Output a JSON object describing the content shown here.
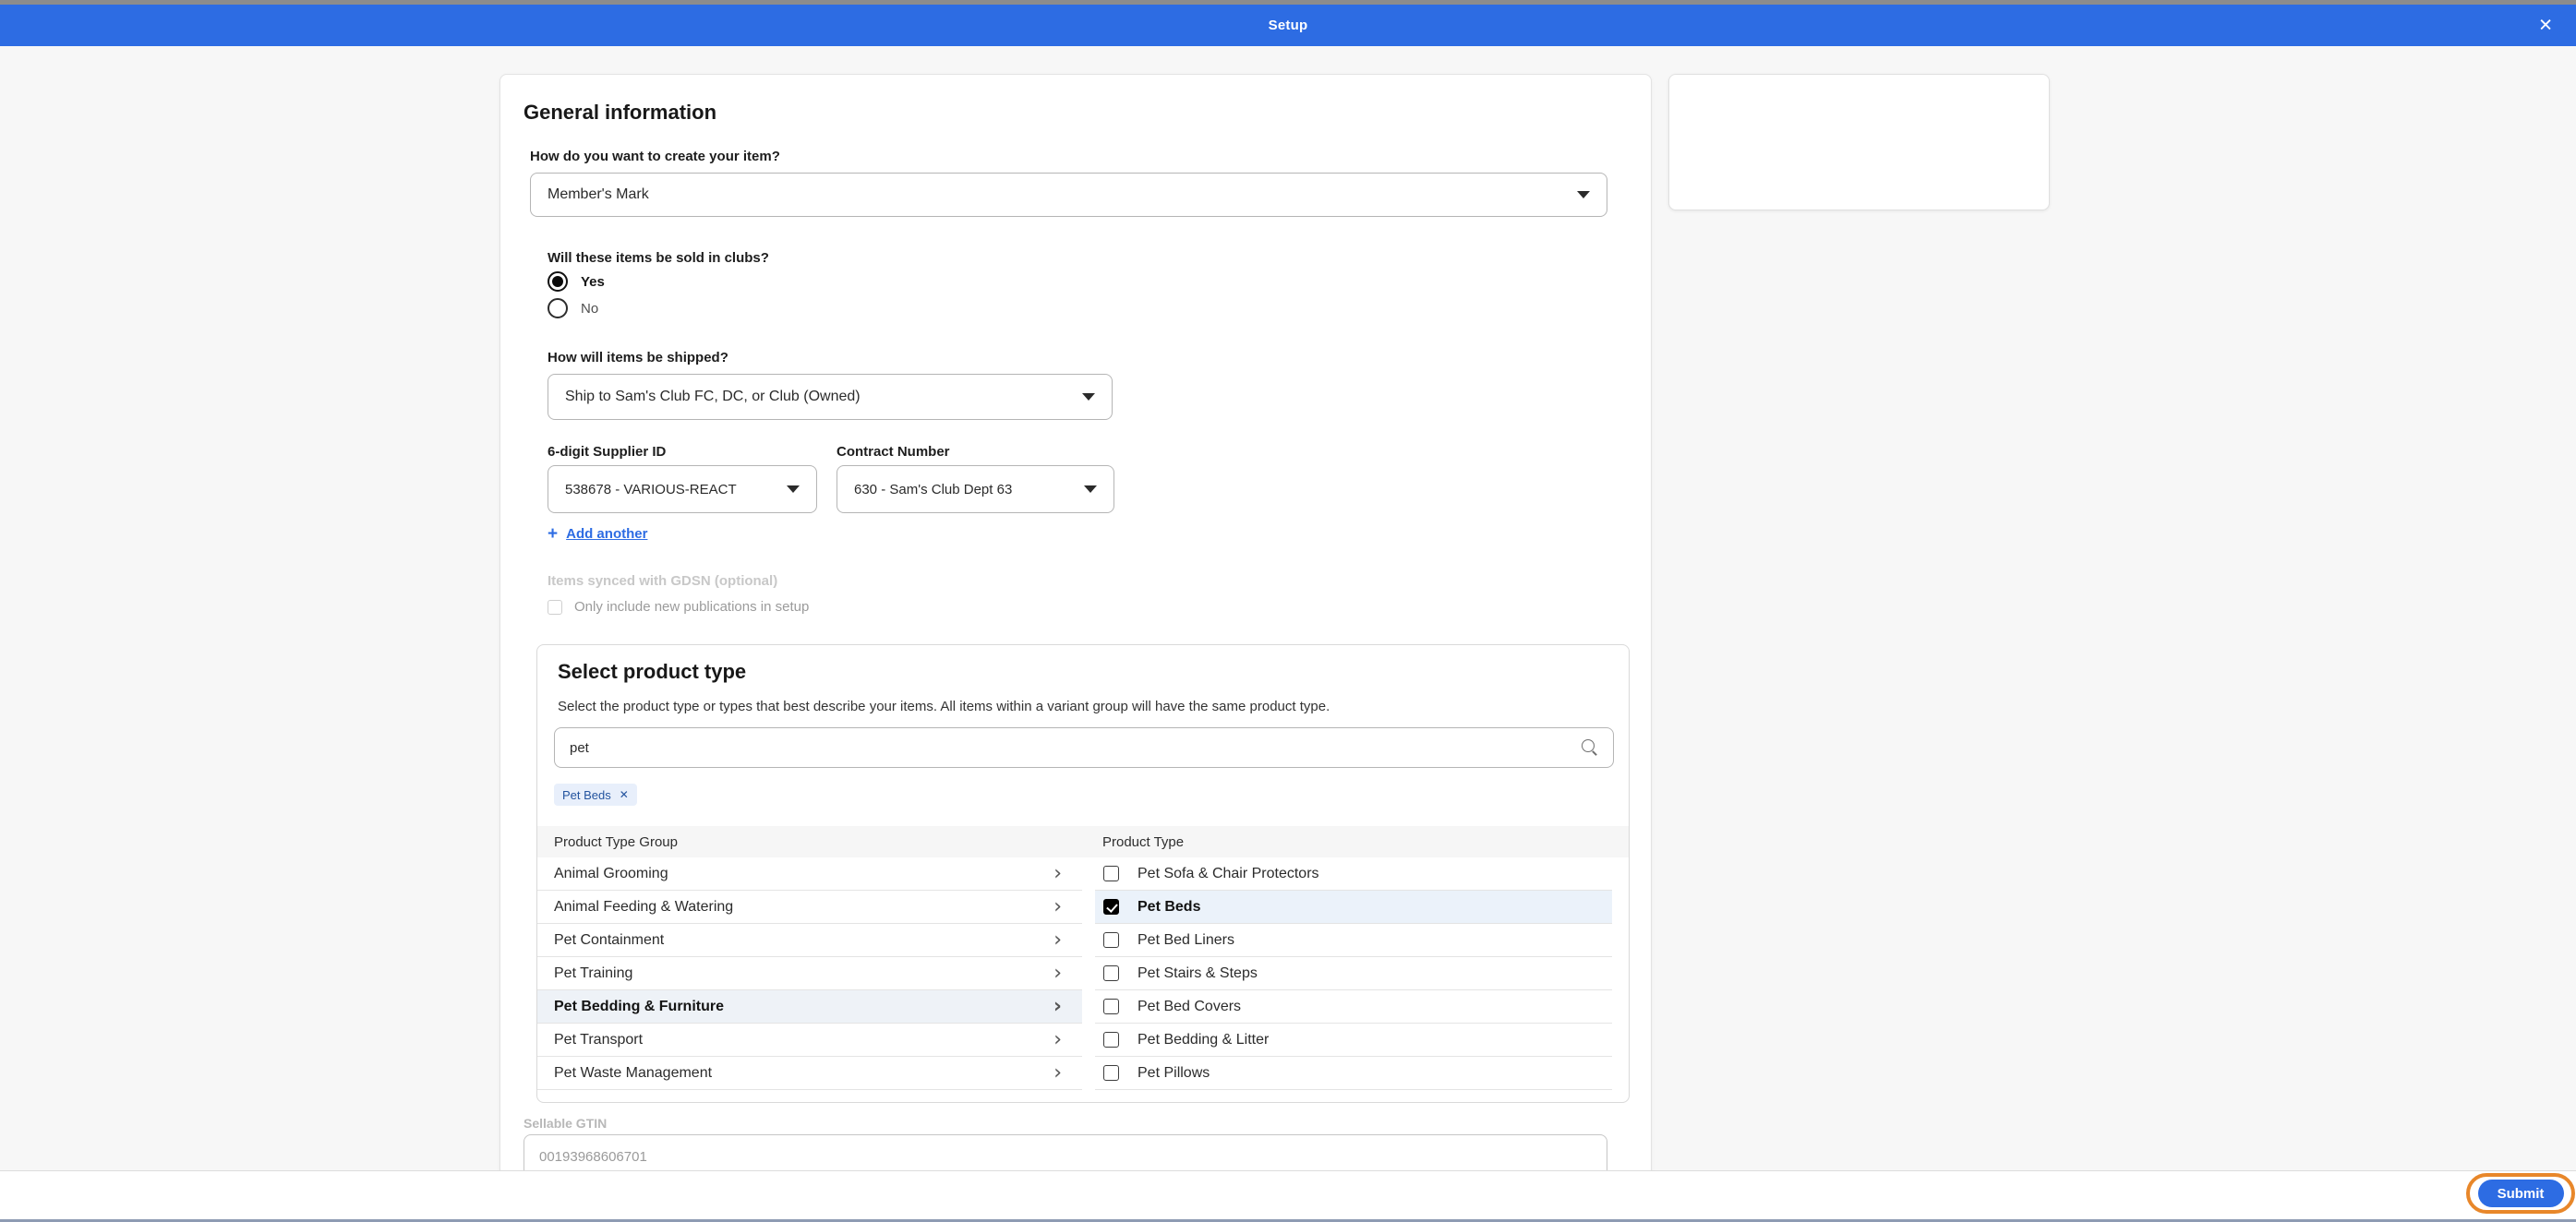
{
  "titlebar": {
    "title": "Setup"
  },
  "icons": {
    "close": "✕",
    "plus": "+",
    "chevron_right": "›",
    "chip_close": "✕"
  },
  "colors": {
    "accent_blue": "#2d6ce3",
    "highlight_ring_orange": "#e8872a",
    "chip_bg": "#e8effb",
    "chip_text": "#24549f"
  },
  "general": {
    "heading": "General information",
    "create_question": {
      "label": "How do you want to create your item?",
      "value": "Member's Mark"
    },
    "clubs_question": {
      "label": "Will these items be sold in clubs?",
      "options": [
        {
          "label": "Yes",
          "selected": true
        },
        {
          "label": "No",
          "selected": false
        }
      ]
    },
    "shipping_question": {
      "label": "How will items be shipped?",
      "value": "Ship to Sam's Club FC, DC, or Club (Owned)"
    },
    "supplier": {
      "label": "6-digit Supplier ID",
      "value": "538678 - VARIOUS-REACT"
    },
    "contract": {
      "label": "Contract Number",
      "value": "630 - Sam's Club Dept 63"
    },
    "add_another_label": "Add another",
    "gdsn": {
      "label": "Items synced with GDSN (optional)",
      "checkbox_label": "Only include new publications in setup",
      "checked": false
    }
  },
  "product_type": {
    "heading": "Select product type",
    "description": "Select the product type or types that best describe your items. All items within a variant group will have the same product type.",
    "search_value": "pet",
    "chips": [
      {
        "label": "Pet Beds"
      }
    ],
    "group_header": "Product Type Group",
    "type_header": "Product Type",
    "groups": [
      {
        "label": "Animal Grooming",
        "selected": false
      },
      {
        "label": "Animal Feeding & Watering",
        "selected": false
      },
      {
        "label": "Pet Containment",
        "selected": false
      },
      {
        "label": "Pet Training",
        "selected": false
      },
      {
        "label": "Pet Bedding & Furniture",
        "selected": true
      },
      {
        "label": "Pet Transport",
        "selected": false
      },
      {
        "label": "Pet Waste Management",
        "selected": false
      }
    ],
    "types": [
      {
        "label": "Pet Sofa & Chair Protectors",
        "checked": false
      },
      {
        "label": "Pet Beds",
        "checked": true
      },
      {
        "label": "Pet Bed Liners",
        "checked": false
      },
      {
        "label": "Pet Stairs & Steps",
        "checked": false
      },
      {
        "label": "Pet Bed Covers",
        "checked": false
      },
      {
        "label": "Pet Bedding & Litter",
        "checked": false
      },
      {
        "label": "Pet Pillows",
        "checked": false
      }
    ]
  },
  "gtin": {
    "label": "Sellable GTIN",
    "placeholder": "00193968606701"
  },
  "footer": {
    "submit_label": "Submit"
  }
}
